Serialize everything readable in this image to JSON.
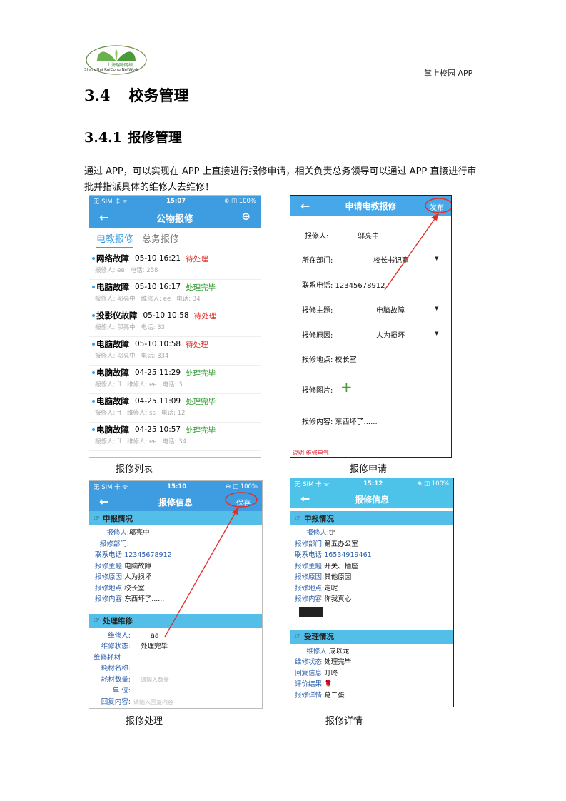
{
  "header": {
    "logo_cn": "上海瑞聪网络",
    "logo_en": "ShangHai RuiCong NetWork",
    "doc_title": "掌上校园 APP"
  },
  "section": {
    "num": "3.4",
    "title": "校务管理"
  },
  "subsection": {
    "num": "3.4.1",
    "title": "报修管理"
  },
  "intro": "通过 APP，可以实现在 APP 上直接进行报修申请，相关负责总务领导可以通过 APP 直接进行审批并指派具体的维修人去维修！",
  "captions": {
    "list": "报修列表",
    "apply": "报修申请",
    "process": "报修处理",
    "detail": "报修详情"
  },
  "phone1": {
    "status_left": "无 SIM 卡 ᯤ",
    "status_time": "15:07",
    "status_right": "⊕ ◫ 100%",
    "title": "公物报修",
    "back": "←",
    "add": "⊕",
    "tabs": [
      "电教报修",
      "总务报修"
    ],
    "items": [
      {
        "title": "网络故障",
        "time": "05-10 16:21",
        "status": "待处理",
        "meta": "报修人: ee   电话: 258"
      },
      {
        "title": "电脑故障",
        "time": "05-10 16:17",
        "status": "处理完毕",
        "meta": "报修人: 邬亮中   维修人: ee   电话: 34"
      },
      {
        "title": "投影仪故障",
        "time": "05-10 10:58",
        "status": "待处理",
        "meta": "报修人: 邬亮中   电话: 33"
      },
      {
        "title": "电脑故障",
        "time": "05-10 10:58",
        "status": "待处理",
        "meta": "报修人: 邬亮中   电话: 334"
      },
      {
        "title": "电脑故障",
        "time": "04-25 11:29",
        "status": "处理完毕",
        "meta": "报修人: ff   维修人: ee   电话: 3"
      },
      {
        "title": "电脑故障",
        "time": "04-25 11:09",
        "status": "处理完毕",
        "meta": "报修人: ff   维修人: ss   电话: 12"
      },
      {
        "title": "电脑故障",
        "time": "04-25 10:57",
        "status": "处理完毕",
        "meta": "报修人: ff   维修人: ee   电话: 34"
      }
    ]
  },
  "phone2": {
    "title": "申请电教报修",
    "back": "←",
    "publish": "发布",
    "reporter_label": "报修人:",
    "reporter": "邬亮中",
    "dept_label": "所在部门:",
    "dept": "校长书记室",
    "phone": "联系电话: 12345678912",
    "topic_label": "报修主题:",
    "topic": "电脑故障",
    "reason_label": "报修原因:",
    "reason": "人为损坏",
    "location": "报修地点: 校长室",
    "image_label": "报修图片:",
    "plus": "+",
    "content": "报修内容: 东西坏了......",
    "note": "说明:维修电气"
  },
  "phone3": {
    "status_left": "无 SIM 卡 ᯤ",
    "status_time": "15:10",
    "status_right": "⊕ ◫ 100%",
    "title": "报修信息",
    "back": "←",
    "save": "保存",
    "sec1": "申报情况",
    "hand": "☞",
    "rows1": [
      {
        "k": "报修人:",
        "v": "邬亮中"
      },
      {
        "k": "报修部门:",
        "v": ""
      },
      {
        "k": "联系电话:",
        "v": "12345678912"
      },
      {
        "k": "报修主题:",
        "v": "电脑故障"
      },
      {
        "k": "报修原因:",
        "v": "人为损坏"
      },
      {
        "k": "报修地点:",
        "v": "校长室"
      },
      {
        "k": "报修内容:",
        "v": "东西坏了......"
      }
    ],
    "sec2": "处理维修",
    "repairer_label": "维修人:",
    "repairer": "aa",
    "state_label": "维修状态:",
    "state": "处理完毕",
    "material_title": "维修耗材",
    "mat_name_label": "耗材名称:",
    "mat_qty_label": "耗材数量:",
    "mat_qty_ph": "请输入数量",
    "unit_label": "单  位:",
    "reply_label": "回复内容:",
    "reply_ph": "请输入回复内容"
  },
  "phone4": {
    "status_left": "无 SIM 卡 ᯤ",
    "status_time": "15:12",
    "status_right": "⊕ ◫ 100%",
    "title": "报修信息",
    "back": "←",
    "sec1": "申报情况",
    "hand": "☞",
    "rows1": [
      {
        "k": "报修人:",
        "v": "th"
      },
      {
        "k": "报修部门:",
        "v": "第五办公室"
      },
      {
        "k": "联系电话:",
        "v": "16534919461"
      },
      {
        "k": "报修主题:",
        "v": "开关、插座"
      },
      {
        "k": "报修原因:",
        "v": "其他原因"
      },
      {
        "k": "报修地点:",
        "v": "定呢"
      },
      {
        "k": "报修内容:",
        "v": "你我真心"
      }
    ],
    "sec2": "受理情况",
    "rows2": [
      {
        "k": "维修人:",
        "v": "成以龙"
      },
      {
        "k": "维修状态:",
        "v": "处理完毕"
      },
      {
        "k": "回复信息:",
        "v": "叮咚"
      },
      {
        "k": "评价结果:",
        "v": "🌹"
      },
      {
        "k": "报修详情:",
        "v": "葛二蛋"
      }
    ]
  }
}
